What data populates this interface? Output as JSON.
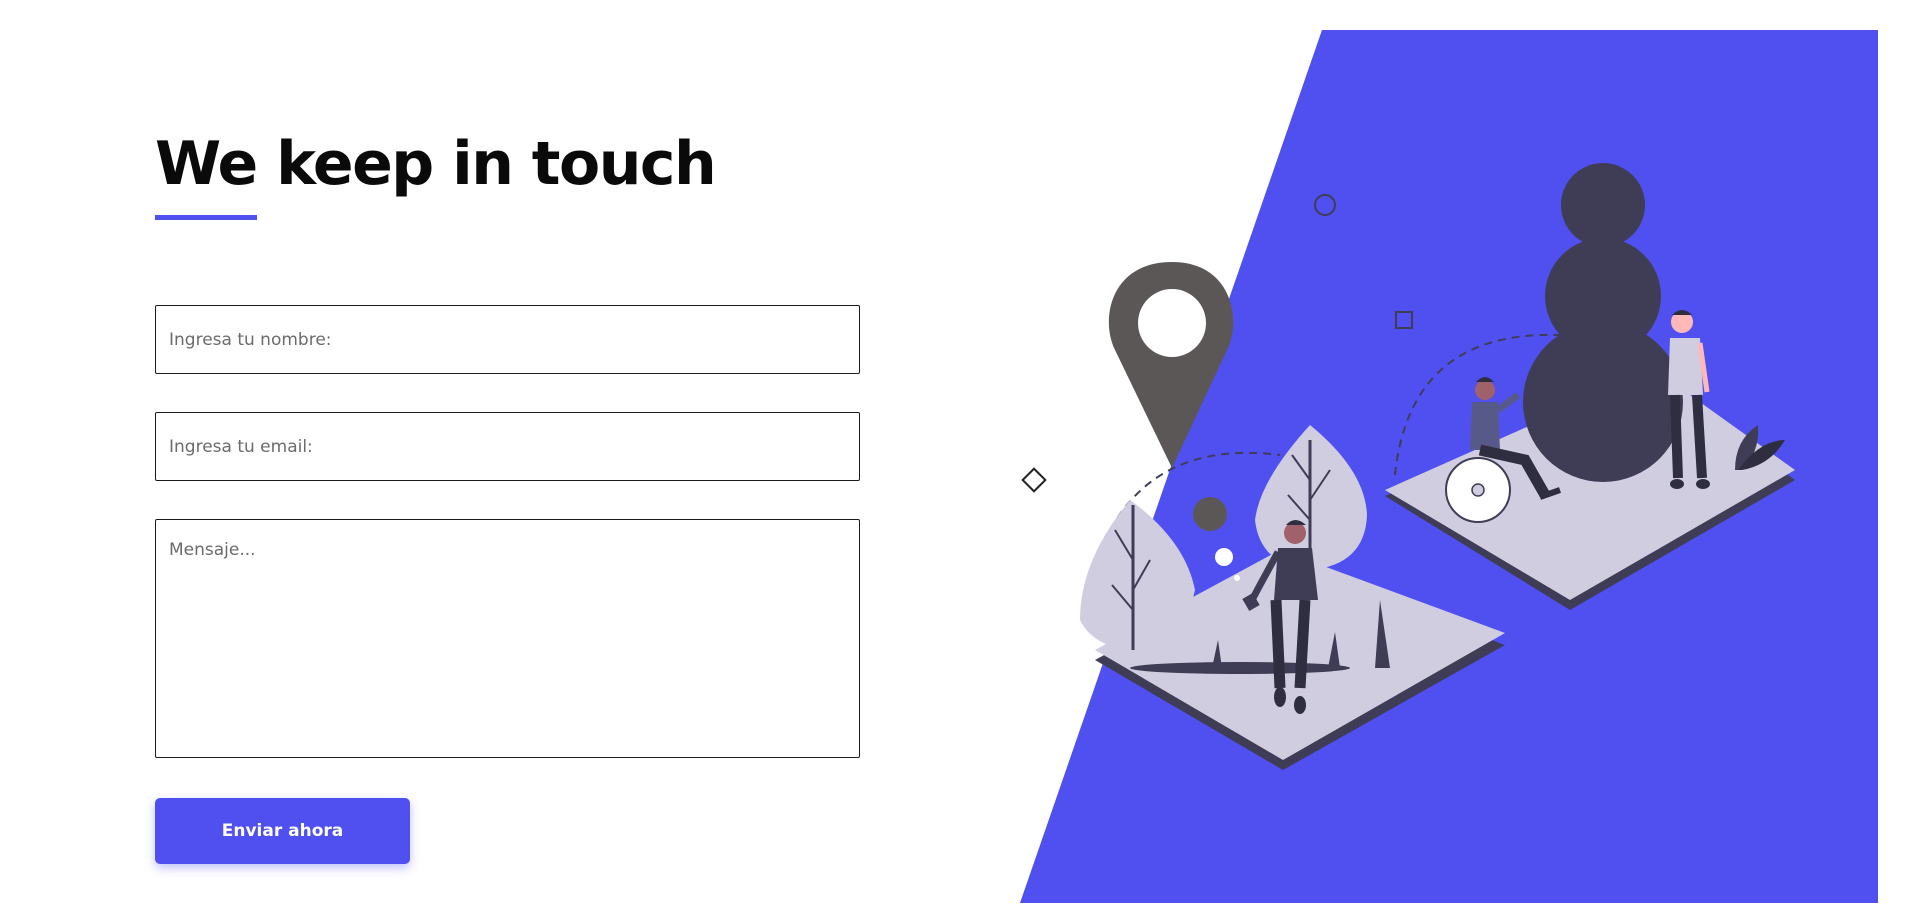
{
  "contact": {
    "title": "We keep in touch",
    "name_placeholder": "Ingresa tu nombre:",
    "email_placeholder": "Ingresa tu email:",
    "message_placeholder": "Mensaje...",
    "submit_label": "Enviar ahora"
  },
  "colors": {
    "accent": "#5050f0",
    "panel": "#5050f0",
    "dark": "#3f3d56",
    "pin": "#5c5757",
    "platform": "#d0cde1"
  },
  "illustration": {
    "icons": [
      "location-pin-icon",
      "circle-outline-icon",
      "square-outline-icon",
      "diamond-outline-icon"
    ],
    "figures": [
      "walking-person",
      "person-in-wheelchair",
      "standing-person",
      "stacked-circles-statue"
    ]
  }
}
